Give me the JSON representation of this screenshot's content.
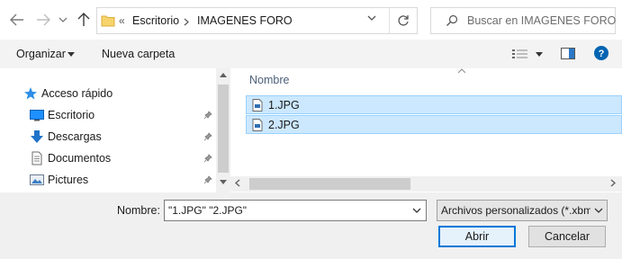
{
  "address_bar": {
    "overflow": "«",
    "crumbs": [
      "Escritorio",
      "IMAGENES FORO"
    ],
    "back_icon": "arrow-left-icon",
    "forward_icon": "arrow-right-icon",
    "recent_icon": "chevron-down-icon",
    "up_icon": "arrow-up-icon",
    "refresh_icon": "refresh-icon"
  },
  "search": {
    "placeholder": "Buscar en IMAGENES FORO",
    "icon": "search-icon"
  },
  "toolbar": {
    "organize_label": "Organizar",
    "new_folder_label": "Nueva carpeta",
    "view_icon": "view-options-icon",
    "pane_icon": "preview-pane-icon",
    "help_icon": "help-icon"
  },
  "sidebar": {
    "items": [
      {
        "label": "Acceso rápido",
        "icon": "star-icon",
        "pinned": false
      },
      {
        "label": "Escritorio",
        "icon": "desktop-icon",
        "pinned": true
      },
      {
        "label": "Descargas",
        "icon": "download-arrow-icon",
        "pinned": true
      },
      {
        "label": "Documentos",
        "icon": "document-icon",
        "pinned": true
      },
      {
        "label": "Pictures",
        "icon": "pictures-icon",
        "pinned": true
      }
    ]
  },
  "files": {
    "column_header": "Nombre",
    "rows": [
      {
        "name": "1.JPG",
        "selected": true
      },
      {
        "name": "2.JPG",
        "selected": true
      }
    ]
  },
  "footer": {
    "filename_label": "Nombre:",
    "filename_value": "\"1.JPG\" \"2.JPG\"",
    "filetype_value": "Archivos personalizados (*.xbm",
    "open_label": "Abrir",
    "cancel_label": "Cancelar"
  },
  "colors": {
    "selection_bg": "#cce8ff",
    "selection_border": "#99d1ff",
    "accent": "#0078d7",
    "toolbar_bg": "#f3f3f3",
    "footer_bg": "#f0f0f0"
  }
}
